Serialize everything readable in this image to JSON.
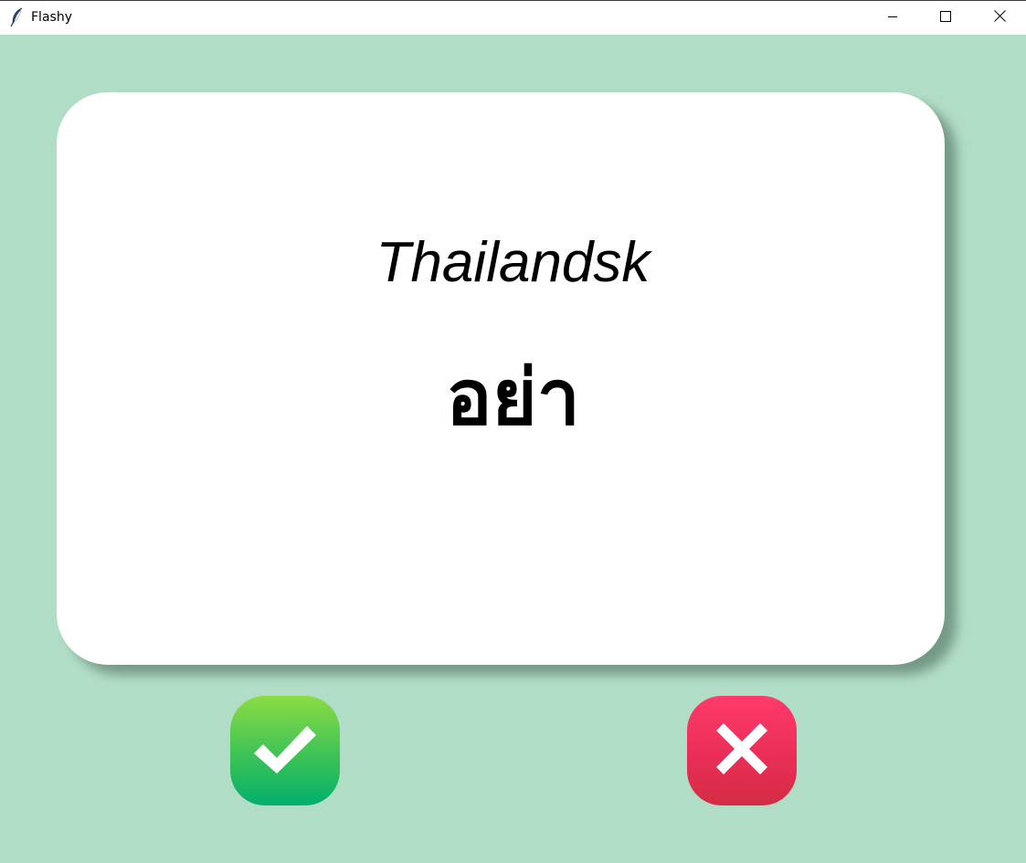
{
  "window": {
    "title": "Flashy",
    "app_icon": "feather-icon",
    "controls": {
      "minimize_icon": "minimize-icon",
      "maximize_icon": "maximize-icon",
      "close_icon": "close-icon"
    }
  },
  "card": {
    "language": "Thailandsk",
    "word": "อย่า"
  },
  "buttons": {
    "right_icon": "checkmark-icon",
    "wrong_icon": "cross-icon"
  },
  "colors": {
    "background": "#b1ddc6",
    "card": "#ffffff",
    "right_button": "#3dc257",
    "wrong_button": "#ea2e57"
  }
}
